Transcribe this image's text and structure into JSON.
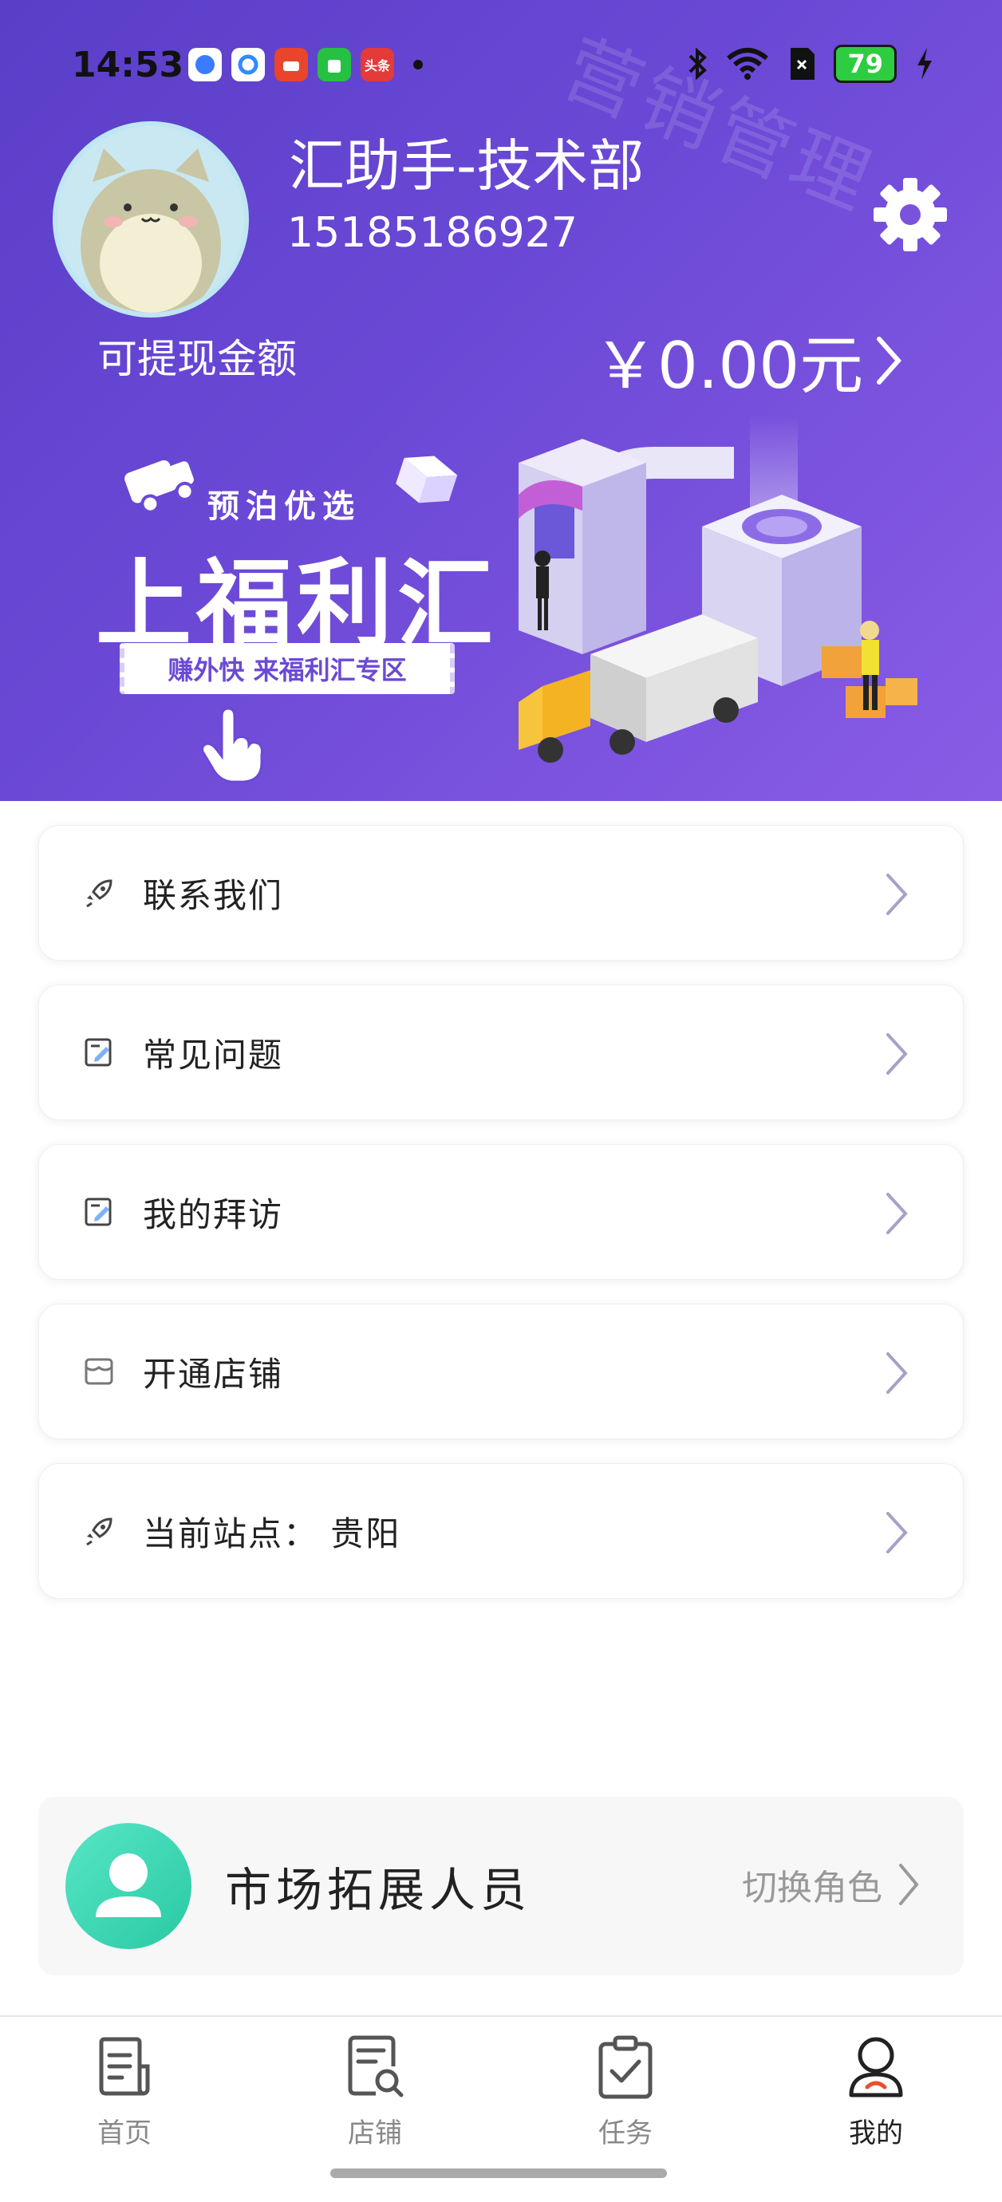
{
  "status_bar": {
    "time": "14:53",
    "apps": [
      {
        "icon": "blue-circle-app-icon",
        "color": "#3a7bff",
        "text": ""
      },
      {
        "icon": "q-app-icon",
        "color": "#2f8cff",
        "text": ""
      },
      {
        "icon": "cart-app-icon",
        "color": "#e8452c",
        "text": ""
      },
      {
        "icon": "bag-app-icon",
        "color": "#26c043",
        "text": ""
      },
      {
        "icon": "toutiao-app-icon",
        "color": "#e33a3a",
        "text": "头条"
      }
    ],
    "battery": "79"
  },
  "header": {
    "watermark": "营销管理",
    "username": "汇助手-技术部",
    "phone": "15185186927",
    "withdraw_label": "可提现金额",
    "withdraw_amount": "￥0.00元",
    "bg_start": "#5a3ec8",
    "bg_end": "#8a5ce6"
  },
  "banner": {
    "subtitle": "预泊优选",
    "title": "上福利汇",
    "tag": "赚外快  来福利汇专区"
  },
  "menu": {
    "items": [
      {
        "label": "联系我们",
        "icon": "rocket-icon"
      },
      {
        "label": "常见问题",
        "icon": "edit-doc-icon"
      },
      {
        "label": "我的拜访",
        "icon": "edit-doc-icon"
      },
      {
        "label": "开通店铺",
        "icon": "store-icon"
      },
      {
        "label": "当前站点：  贵阳",
        "icon": "rocket-icon"
      }
    ]
  },
  "role": {
    "name": "市场拓展人员",
    "switch_label": "切换角色",
    "accent": "#3fd8b4"
  },
  "tabs": [
    {
      "label": "首页",
      "icon": "home-doc-icon",
      "active": false
    },
    {
      "label": "店铺",
      "icon": "store-search-icon",
      "active": false
    },
    {
      "label": "任务",
      "icon": "clipboard-check-icon",
      "active": false
    },
    {
      "label": "我的",
      "icon": "user-icon",
      "active": true
    }
  ]
}
